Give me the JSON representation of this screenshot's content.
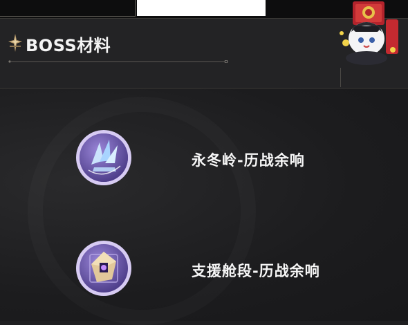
{
  "header": {
    "title": "BOSS材料",
    "title_icon": "spire-emblem-icon",
    "mascot": "pom-pom-conductor-mascot"
  },
  "materials": [
    {
      "name": "永冬岭-历战余响",
      "icon": "ice-crystal-shard-icon"
    },
    {
      "name": "支援舱段-历战余响",
      "icon": "violet-crystal-cube-icon"
    }
  ],
  "colors": {
    "background": "#1f1f21",
    "text": "#f2f2f2",
    "icon_ring": "#c9b8ee",
    "icon_fill": "#6a52a8"
  }
}
